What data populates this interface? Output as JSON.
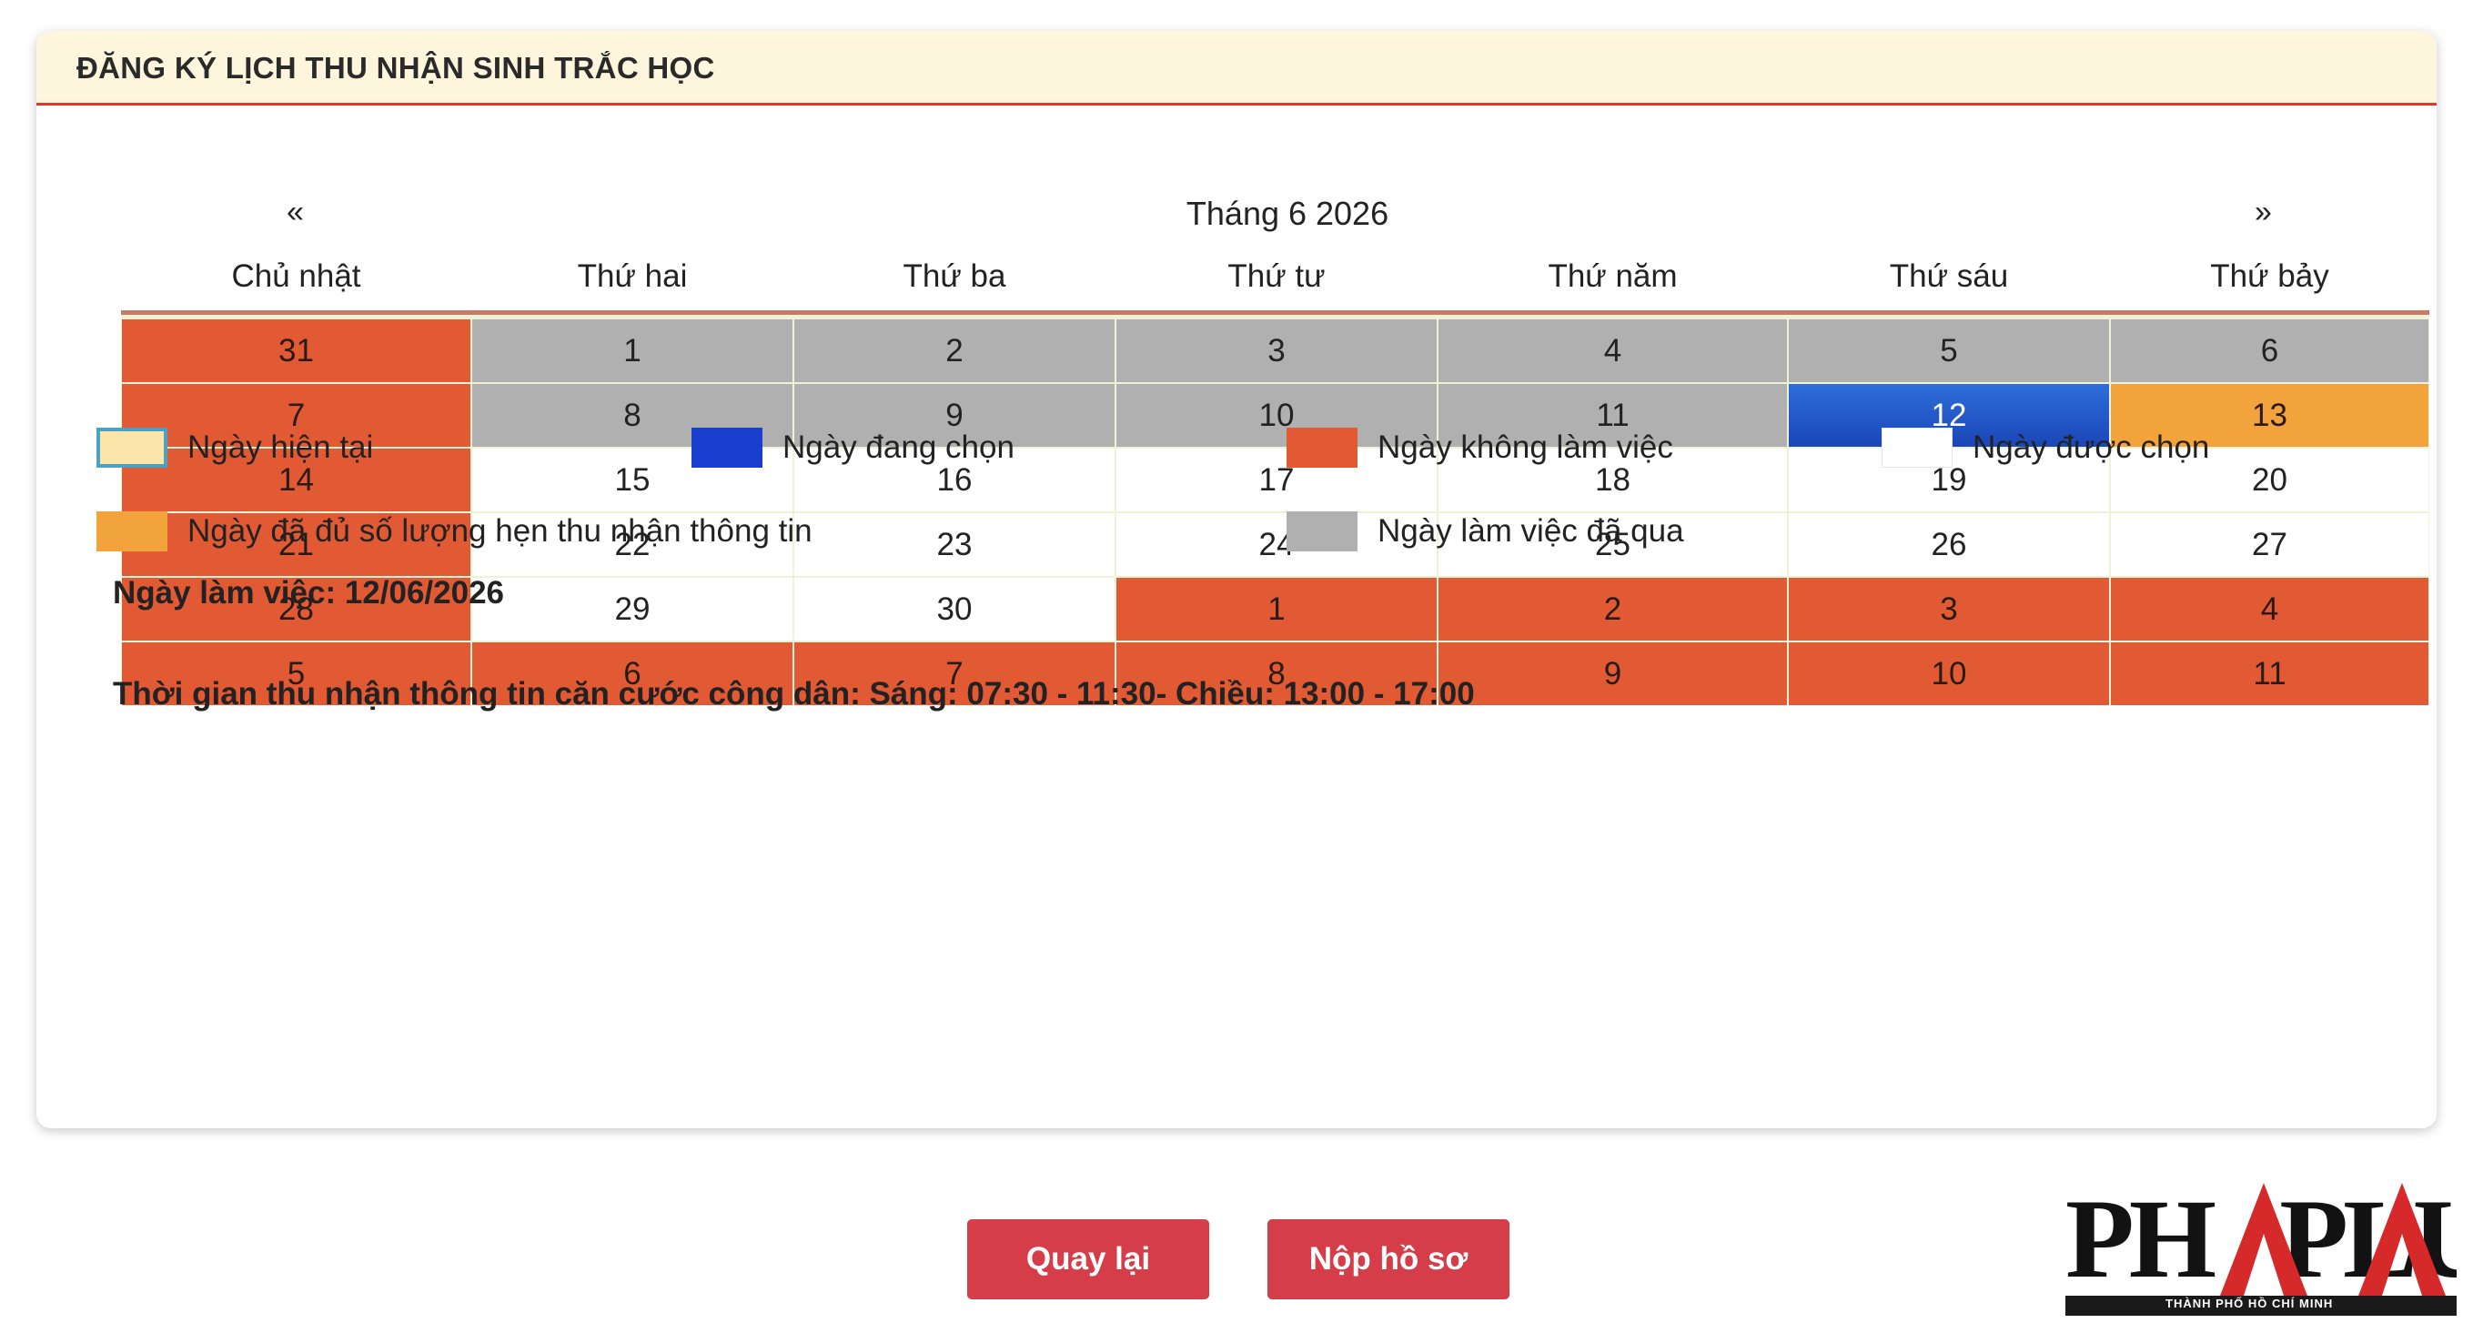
{
  "header": {
    "title": "ĐĂNG KÝ LỊCH THU NHẬN SINH TRẮC HỌC"
  },
  "calendar": {
    "prev_label": "«",
    "next_label": "»",
    "month_title": "Tháng 6 2026",
    "weekdays": [
      "Chủ nhật",
      "Thứ hai",
      "Thứ ba",
      "Thứ tư",
      "Thứ năm",
      "Thứ sáu",
      "Thứ bảy"
    ],
    "weeks": [
      [
        {
          "d": "31",
          "s": "off"
        },
        {
          "d": "1",
          "s": "past"
        },
        {
          "d": "2",
          "s": "past"
        },
        {
          "d": "3",
          "s": "past"
        },
        {
          "d": "4",
          "s": "past"
        },
        {
          "d": "5",
          "s": "past"
        },
        {
          "d": "6",
          "s": "past"
        }
      ],
      [
        {
          "d": "7",
          "s": "off"
        },
        {
          "d": "8",
          "s": "past"
        },
        {
          "d": "9",
          "s": "past"
        },
        {
          "d": "10",
          "s": "past"
        },
        {
          "d": "11",
          "s": "past"
        },
        {
          "d": "12",
          "s": "selected"
        },
        {
          "d": "13",
          "s": "full"
        }
      ],
      [
        {
          "d": "14",
          "s": "off"
        },
        {
          "d": "15",
          "s": "free"
        },
        {
          "d": "16",
          "s": "free"
        },
        {
          "d": "17",
          "s": "free"
        },
        {
          "d": "18",
          "s": "free"
        },
        {
          "d": "19",
          "s": "free"
        },
        {
          "d": "20",
          "s": "free"
        }
      ],
      [
        {
          "d": "21",
          "s": "off"
        },
        {
          "d": "22",
          "s": "free"
        },
        {
          "d": "23",
          "s": "free"
        },
        {
          "d": "24",
          "s": "free"
        },
        {
          "d": "25",
          "s": "free"
        },
        {
          "d": "26",
          "s": "free"
        },
        {
          "d": "27",
          "s": "free"
        }
      ],
      [
        {
          "d": "28",
          "s": "off"
        },
        {
          "d": "29",
          "s": "free"
        },
        {
          "d": "30",
          "s": "free"
        },
        {
          "d": "1",
          "s": "off"
        },
        {
          "d": "2",
          "s": "off"
        },
        {
          "d": "3",
          "s": "off"
        },
        {
          "d": "4",
          "s": "off"
        }
      ],
      [
        {
          "d": "5",
          "s": "off"
        },
        {
          "d": "6",
          "s": "off"
        },
        {
          "d": "7",
          "s": "off"
        },
        {
          "d": "8",
          "s": "off"
        },
        {
          "d": "9",
          "s": "off"
        },
        {
          "d": "10",
          "s": "off"
        },
        {
          "d": "11",
          "s": "off"
        }
      ]
    ]
  },
  "legend": {
    "current": "Ngày hiện tại",
    "selected": "Ngày đang chọn",
    "off": "Ngày không làm việc",
    "free": "Ngày được chọn",
    "full": "Ngày đã đủ số lượng hẹn thu nhận thông tin",
    "past": "Ngày làm việc đã qua"
  },
  "info": {
    "work_day": "Ngày làm việc: 12/06/2026",
    "hours": "Thời gian thu nhận thông tin căn cước công dân: Sáng: 07:30 - 11:30- Chiều: 13:00 - 17:00"
  },
  "buttons": {
    "back": "Quay lại",
    "submit": "Nộp hồ sơ"
  },
  "logo": {
    "text": "PHÁPLUẬT",
    "sub": "THÀNH PHỐ HỒ CHÍ MINH"
  },
  "colors": {
    "off": "#e25a34",
    "past": "#b0b0b0",
    "selected": "#1b46b8",
    "full": "#f2a33c",
    "current": "#fbe5a8",
    "button": "#d53d48",
    "header_rule": "#e2352b"
  }
}
